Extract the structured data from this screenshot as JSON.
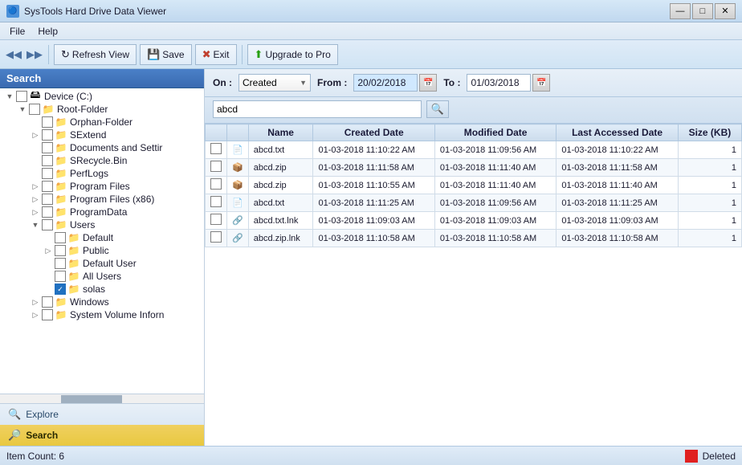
{
  "app": {
    "title": "SysTools Hard Drive Data Viewer",
    "title_icon": "🔵"
  },
  "title_controls": {
    "minimize": "—",
    "maximize": "□",
    "close": "✕"
  },
  "menu": {
    "items": [
      "File",
      "Help"
    ]
  },
  "toolbar": {
    "nav_prev": "◀",
    "nav_next": "▶",
    "refresh_icon": "↻",
    "refresh_label": "Refresh View",
    "save_icon": "💾",
    "save_label": "Save",
    "exit_icon": "🚪",
    "exit_label": "Exit",
    "upgrade_icon": "⬆",
    "upgrade_label": "Upgrade to Pro"
  },
  "search_bar": {
    "on_label": "On :",
    "on_value": "Created",
    "from_label": "From :",
    "from_date": "20/02/2018",
    "to_label": "To :",
    "to_date": "01/03/2018",
    "search_text": "abcd"
  },
  "sidebar": {
    "title": "Search",
    "tree": [
      {
        "id": "device-c",
        "label": "Device (C:)",
        "indent": 0,
        "type": "drive",
        "expanded": true,
        "checked": false
      },
      {
        "id": "root-folder",
        "label": "Root-Folder",
        "indent": 1,
        "type": "folder",
        "expanded": true,
        "checked": false
      },
      {
        "id": "orphan-folder",
        "label": "Orphan-Folder",
        "indent": 2,
        "type": "folder",
        "expanded": false,
        "checked": false
      },
      {
        "id": "sextend",
        "label": "SExtend",
        "indent": 2,
        "type": "folder",
        "expanded": false,
        "checked": false
      },
      {
        "id": "documents",
        "label": "Documents and Settir",
        "indent": 2,
        "type": "folder",
        "expanded": false,
        "checked": false
      },
      {
        "id": "srecycle",
        "label": "SRecycle.Bin",
        "indent": 2,
        "type": "folder",
        "expanded": false,
        "checked": false
      },
      {
        "id": "perflogs",
        "label": "PerfLogs",
        "indent": 2,
        "type": "folder",
        "expanded": false,
        "checked": false
      },
      {
        "id": "program-files",
        "label": "Program Files",
        "indent": 2,
        "type": "folder",
        "expanded": false,
        "checked": false
      },
      {
        "id": "program-files-x86",
        "label": "Program Files (x86)",
        "indent": 2,
        "type": "folder",
        "expanded": false,
        "checked": false
      },
      {
        "id": "programdata",
        "label": "ProgramData",
        "indent": 2,
        "type": "folder",
        "expanded": false,
        "checked": false
      },
      {
        "id": "users",
        "label": "Users",
        "indent": 2,
        "type": "folder",
        "expanded": true,
        "checked": false
      },
      {
        "id": "default",
        "label": "Default",
        "indent": 3,
        "type": "folder",
        "expanded": false,
        "checked": false
      },
      {
        "id": "public",
        "label": "Public",
        "indent": 3,
        "type": "folder",
        "expanded": false,
        "checked": false
      },
      {
        "id": "default-user",
        "label": "Default User",
        "indent": 3,
        "type": "folder",
        "expanded": false,
        "checked": false
      },
      {
        "id": "all-users",
        "label": "All Users",
        "indent": 3,
        "type": "folder",
        "expanded": false,
        "checked": false
      },
      {
        "id": "solas",
        "label": "solas",
        "indent": 3,
        "type": "folder",
        "expanded": false,
        "checked": true
      },
      {
        "id": "windows",
        "label": "Windows",
        "indent": 2,
        "type": "folder",
        "expanded": false,
        "checked": false
      },
      {
        "id": "system-volume",
        "label": "System Volume Inforn",
        "indent": 2,
        "type": "folder",
        "expanded": false,
        "checked": false
      }
    ],
    "explore_label": "Explore",
    "search_label": "Search"
  },
  "table": {
    "columns": [
      "",
      "",
      "Name",
      "Created Date",
      "Modified Date",
      "Last Accessed Date",
      "Size (KB)"
    ],
    "rows": [
      {
        "name": "abcd.txt",
        "type": "txt",
        "created": "01-03-2018 11:10:22 AM",
        "modified": "01-03-2018 11:09:56 AM",
        "accessed": "01-03-2018 11:10:22 AM",
        "size": "1"
      },
      {
        "name": "abcd.zip",
        "type": "zip",
        "created": "01-03-2018 11:11:58 AM",
        "modified": "01-03-2018 11:11:40 AM",
        "accessed": "01-03-2018 11:11:58 AM",
        "size": "1"
      },
      {
        "name": "abcd.zip",
        "type": "zip",
        "created": "01-03-2018 11:10:55 AM",
        "modified": "01-03-2018 11:11:40 AM",
        "accessed": "01-03-2018 11:11:40 AM",
        "size": "1"
      },
      {
        "name": "abcd.txt",
        "type": "txt",
        "created": "01-03-2018 11:11:25 AM",
        "modified": "01-03-2018 11:09:56 AM",
        "accessed": "01-03-2018 11:11:25 AM",
        "size": "1"
      },
      {
        "name": "abcd.txt.lnk",
        "type": "lnk",
        "created": "01-03-2018 11:09:03 AM",
        "modified": "01-03-2018 11:09:03 AM",
        "accessed": "01-03-2018 11:09:03 AM",
        "size": "1"
      },
      {
        "name": "abcd.zip.lnk",
        "type": "lnk",
        "created": "01-03-2018 11:10:58 AM",
        "modified": "01-03-2018 11:10:58 AM",
        "accessed": "01-03-2018 11:10:58 AM",
        "size": "1"
      }
    ]
  },
  "status": {
    "item_count_label": "Item Count:",
    "item_count": "6",
    "deleted_label": "Deleted",
    "deleted_color": "#e02020"
  }
}
